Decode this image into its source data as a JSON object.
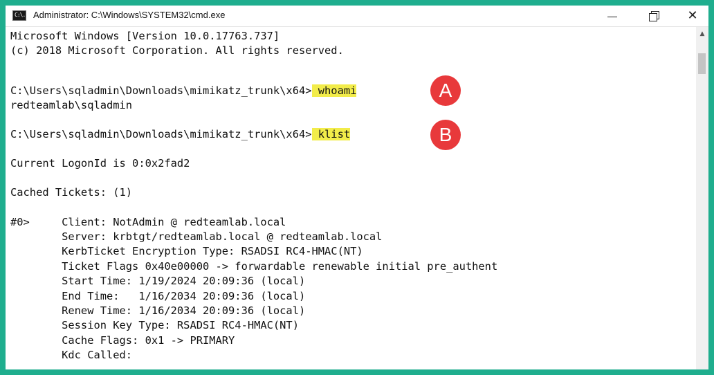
{
  "window": {
    "title": "Administrator: C:\\Windows\\SYSTEM32\\cmd.exe",
    "icon_text": "C:\\.",
    "controls": {
      "minimize_icon": "minimize-icon",
      "maximize_icon": "restore-icon",
      "close_glyph": "✕"
    }
  },
  "console": {
    "lines": [
      "Microsoft Windows [Version 10.0.17763.737]",
      "(c) 2018 Microsoft Corporation. All rights reserved.",
      "",
      "C:\\Users\\sqladmin\\Downloads\\mimikatz_trunk\\x64>",
      "redteamlab\\sqladmin",
      "",
      "C:\\Users\\sqladmin\\Downloads\\mimikatz_trunk\\x64>",
      "",
      "Current LogonId is 0:0x2fad2",
      "",
      "Cached Tickets: (1)",
      "",
      "#0>     Client: NotAdmin @ redteamlab.local",
      "        Server: krbtgt/redteamlab.local @ redteamlab.local",
      "        KerbTicket Encryption Type: RSADSI RC4-HMAC(NT)",
      "        Ticket Flags 0x40e00000 -> forwardable renewable initial pre_authent",
      "        Start Time: 1/19/2024 20:09:36 (local)",
      "        End Time:   1/16/2034 20:09:36 (local)",
      "        Renew Time: 1/16/2034 20:09:36 (local)",
      "        Session Key Type: RSADSI RC4-HMAC(NT)",
      "        Cache Flags: 0x1 -> PRIMARY",
      "        Kdc Called:"
    ],
    "commands": [
      " whoami",
      " klist"
    ]
  },
  "annotations": {
    "a": "A",
    "b": "B"
  },
  "colors": {
    "frame": "#1fae8e",
    "highlight": "#f2ec4a",
    "marker": "#e8393b",
    "text": "#111111",
    "background": "#ffffff"
  },
  "scrollbar": {
    "up_arrow_icon": "chevron-up-icon"
  }
}
